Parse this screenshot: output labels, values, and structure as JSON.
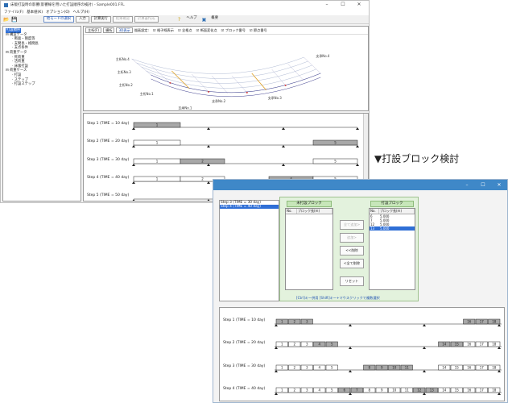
{
  "window1": {
    "title": "床版打設時の影響(影響線を用いた打設順序の検討) - Sample001.FFL",
    "window_controls": [
      "–",
      "☐",
      "✕"
    ],
    "menu": [
      "ファイル(F)",
      "基本値(K)",
      "オプション(O)",
      "ヘルプ(H)"
    ],
    "toolbar": [
      "他モードの選択",
      "入力",
      "計算実行",
      "結果確認",
      "計算書作成",
      "ヘルプ",
      "概要"
    ],
    "tree": [
      "打設順序",
      "構造データ",
      "断面・剛度等",
      "支間長・格間長",
      "支点条件",
      "荷重データ",
      "死荷重",
      "活荷重",
      "床版打設",
      "荷重ケース",
      "打設",
      "ステップ",
      "打設ステップ"
    ],
    "view_tabs": [
      "主桁(F)",
      "横桁",
      "3D表示"
    ],
    "view_options": [
      "描画設定:",
      "格子線表示",
      "全格点",
      "断面変化点",
      "ブロック番号",
      "節点番号"
    ],
    "model_labels": [
      "主桁No.4",
      "主桁No.3",
      "主桁No.2",
      "主桁No.1",
      "支承No.4",
      "支承No.3",
      "支承No.2",
      "支承No.1"
    ],
    "steps": [
      {
        "label": "Step 1  (TIME = 10 day)",
        "blocks": [
          "1"
        ]
      },
      {
        "label": "Step 2  (TIME = 20 day)",
        "blocks": [
          "1",
          "5"
        ]
      },
      {
        "label": "Step 3  (TIME = 30 day)",
        "blocks": [
          "1",
          "2",
          "5"
        ]
      },
      {
        "label": "Step 4  (TIME = 40 day)",
        "blocks": [
          "1",
          "2",
          "4",
          "5"
        ]
      },
      {
        "label": "Step 5  (TIME = 50 day)",
        "blocks": []
      }
    ]
  },
  "caption": "▼打設ブロック検討",
  "window2": {
    "window_controls": [
      "–",
      "☐",
      "✕"
    ],
    "step_list": [
      "Step 3  (TIME = 30 day)",
      "Step 4  (TIME = 40 day)"
    ],
    "left_panel_title": "未打設ブロック",
    "right_panel_title": "打設ブロック",
    "col_no": "No.",
    "col_len": "ブロック長(m)",
    "right_rows": [
      {
        "no": "6",
        "len": "5.000"
      },
      {
        "no": "7",
        "len": "5.000"
      },
      {
        "no": "12",
        "len": "5.000"
      },
      {
        "no": "13",
        "len": "5.000"
      }
    ],
    "buttons": [
      "全て追加>",
      "追加>",
      "<<削除",
      "<全て削除",
      "リセット"
    ],
    "hint": "[Ctrl]キー併用 [Shift]キー+マウスクリックで複数選択",
    "steps": [
      {
        "label": "Step 1  (TIME = 10 day)",
        "cells": [
          "1",
          "2",
          "3",
          "16",
          "17",
          "18"
        ]
      },
      {
        "label": "Step 2  (TIME = 20 day)",
        "cells": [
          "1",
          "2",
          "3",
          "4",
          "5",
          "14",
          "15",
          "16",
          "17",
          "18"
        ]
      },
      {
        "label": "Step 3  (TIME = 30 day)",
        "cells": [
          "1",
          "2",
          "3",
          "4",
          "5",
          "8",
          "9",
          "10",
          "11",
          "14",
          "15",
          "16",
          "17",
          "18"
        ]
      },
      {
        "label": "Step 4  (TIME = 40 day)",
        "cells": [
          "1",
          "2",
          "3",
          "4",
          "5",
          "6",
          "7",
          "8",
          "9",
          "10",
          "11",
          "12",
          "13",
          "14",
          "15",
          "16",
          "17",
          "18"
        ]
      }
    ]
  }
}
